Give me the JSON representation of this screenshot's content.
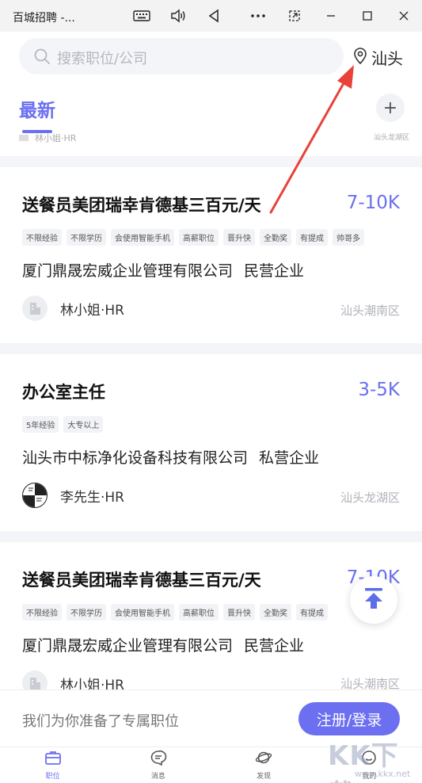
{
  "window": {
    "title": "百城招聘 -...",
    "keyboard_icon": "keyboard-icon",
    "volume_icon": "volume-icon",
    "back_icon": "back-triangle-icon",
    "more_icon": "more-dots-icon",
    "snap_icon": "snap-icon",
    "minimize_icon": "minimize-icon",
    "maximize_icon": "maximize-icon",
    "close_icon": "close-icon"
  },
  "header": {
    "search_placeholder": "搜索职位/公司",
    "location": "汕头"
  },
  "tabs": {
    "latest": "最新",
    "add": "+"
  },
  "peek_row": {
    "recruiter": "林小姐·HR",
    "area": "汕头龙湖区"
  },
  "jobs": [
    {
      "title": "送餐员美团瑞幸肯德基三百元/天",
      "salary": "7-10K",
      "tags": [
        "不限经验",
        "不限学历",
        "会使用智能手机",
        "高薪职位",
        "晋升快",
        "全勤奖",
        "有提成",
        "帅哥多"
      ],
      "company": "厦门鼎晟宏威企业管理有限公司",
      "company_type": "民营企业",
      "recruiter": "林小姐·HR",
      "area": "汕头潮南区"
    },
    {
      "title": "办公室主任",
      "salary": "3-5K",
      "tags": [
        "5年经验",
        "大专以上"
      ],
      "company": "汕头市中标净化设备科技有限公司",
      "company_type": "私营企业",
      "recruiter": "李先生·HR",
      "area": "汕头龙湖区"
    },
    {
      "title": "送餐员美团瑞幸肯德基三百元/天",
      "salary": "7-10K",
      "tags": [
        "不限经验",
        "不限学历",
        "会使用智能手机",
        "高薪职位",
        "晋升快",
        "全勤奖",
        "有提成"
      ],
      "company": "厦门鼎晟宏威企业管理有限公司",
      "company_type": "民营企业",
      "recruiter": "林小姐·HR",
      "area": "汕头潮南区"
    }
  ],
  "register": {
    "text": "我们为你准备了专属职位",
    "button": "注册/登录"
  },
  "tabbar": [
    {
      "label": "职位",
      "icon": "briefcase-icon",
      "active": true
    },
    {
      "label": "消息",
      "icon": "message-icon",
      "active": false
    },
    {
      "label": "发现",
      "icon": "planet-icon",
      "active": false
    },
    {
      "label": "我的",
      "icon": "profile-icon",
      "active": false
    }
  ],
  "watermark": {
    "text": "KK下载",
    "sub": "www.kkx.net"
  },
  "colors": {
    "accent": "#6b6ff0",
    "annotation": "#e8423a"
  }
}
